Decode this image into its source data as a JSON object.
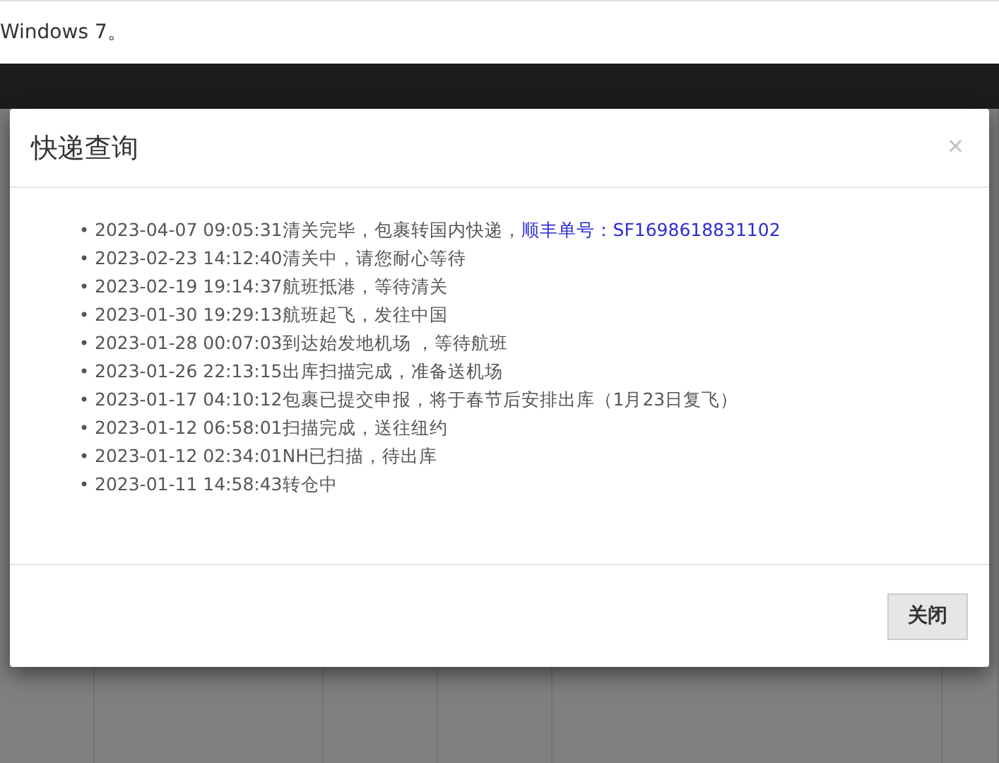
{
  "page": {
    "text": "Windows 7。"
  },
  "bullet": "•",
  "modal": {
    "title": "快递查询",
    "close_glyph": "×",
    "events": [
      {
        "text": "2023-04-07 09:05:31清关完毕，包裹转国内快递，",
        "link": "顺丰单号：SF1698618831102"
      },
      {
        "text": "2023-02-23 14:12:40清关中，请您耐心等待"
      },
      {
        "text": "2023-02-19 19:14:37航班抵港，等待清关"
      },
      {
        "text": "2023-01-30 19:29:13航班起飞，发往中国"
      },
      {
        "text": "2023-01-28 00:07:03到达始发地机场 ，等待航班"
      },
      {
        "text": "2023-01-26 22:13:15出库扫描完成，准备送机场"
      },
      {
        "text": "2023-01-17 04:10:12包裹已提交申报，将于春节后安排出库（1月23日复飞）"
      },
      {
        "text": "2023-01-12 06:58:01扫描完成，送往纽约"
      },
      {
        "text": "2023-01-12 02:34:01NH已扫描，待出库"
      },
      {
        "text": "2023-01-11 14:58:43转仓中"
      }
    ],
    "button": "关闭"
  }
}
